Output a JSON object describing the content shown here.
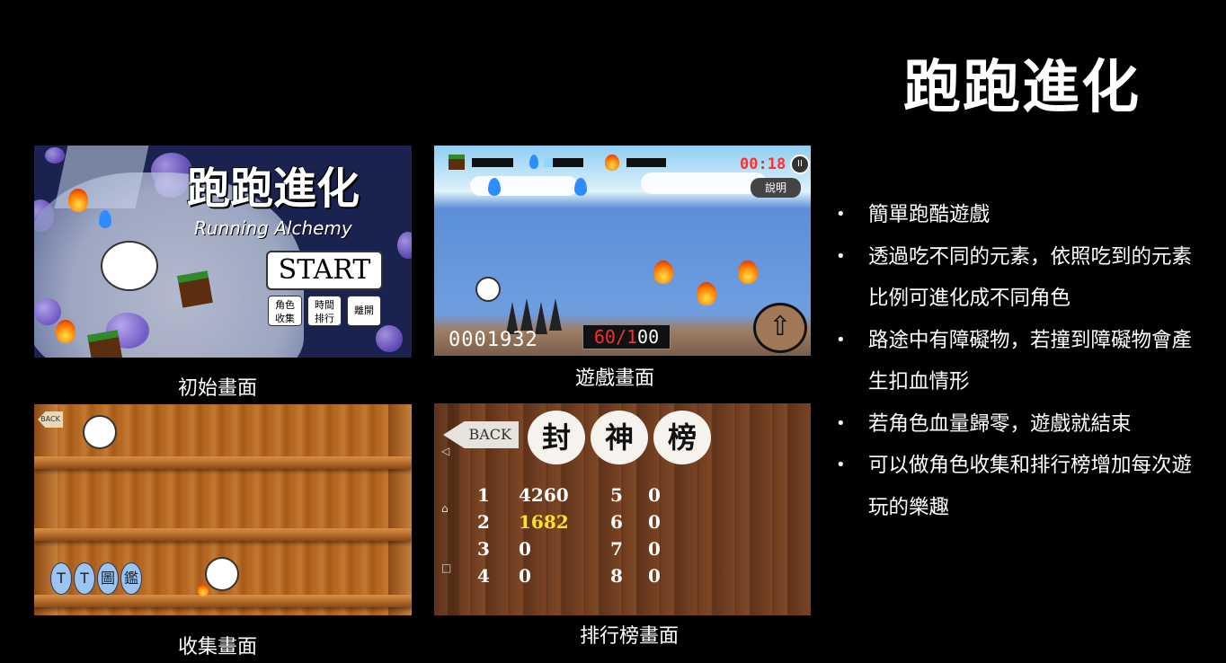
{
  "title": "跑跑進化",
  "screens": {
    "start": {
      "caption": "初始畫面",
      "logo": "跑跑進化",
      "logo_sub": "Running Alchemy",
      "start_label": "START",
      "btn_collect": "角色\n收集",
      "btn_rank": "時間\n排行",
      "btn_exit": "離開"
    },
    "game": {
      "caption": "遊戲畫面",
      "timer": "00:18",
      "help_label": "說明",
      "pause_icon": "pause-icon",
      "score": "0001932",
      "hp_current": "60/1",
      "hp_max": "00",
      "up_icon": "up-arrow-icon"
    },
    "collection": {
      "caption": "收集畫面",
      "back_label": "BACK",
      "tt_label": [
        "T",
        "T",
        "圖",
        "鑑"
      ]
    },
    "ranking": {
      "caption": "排行榜畫面",
      "back_label": "BACK",
      "title_chars": [
        "封",
        "神",
        "榜"
      ],
      "rows": [
        {
          "rank": "1",
          "score": "4260"
        },
        {
          "rank": "2",
          "score": "1682"
        },
        {
          "rank": "3",
          "score": "0"
        },
        {
          "rank": "4",
          "score": "0"
        },
        {
          "rank": "5",
          "score": "0"
        },
        {
          "rank": "6",
          "score": "0"
        },
        {
          "rank": "7",
          "score": "0"
        },
        {
          "rank": "8",
          "score": "0"
        }
      ],
      "nav_icons": [
        "back-triangle-icon",
        "home-icon",
        "recent-apps-icon"
      ]
    }
  },
  "bullets": [
    "簡單跑酷遊戲",
    "透過吃不同的元素，依照吃到的元素比例可進化成不同角色",
    "路途中有障礙物，若撞到障礙物會產生扣血情形",
    "若角色血量歸零，遊戲就結束",
    "可以做角色收集和排行榜增加每次遊玩的樂趣"
  ]
}
